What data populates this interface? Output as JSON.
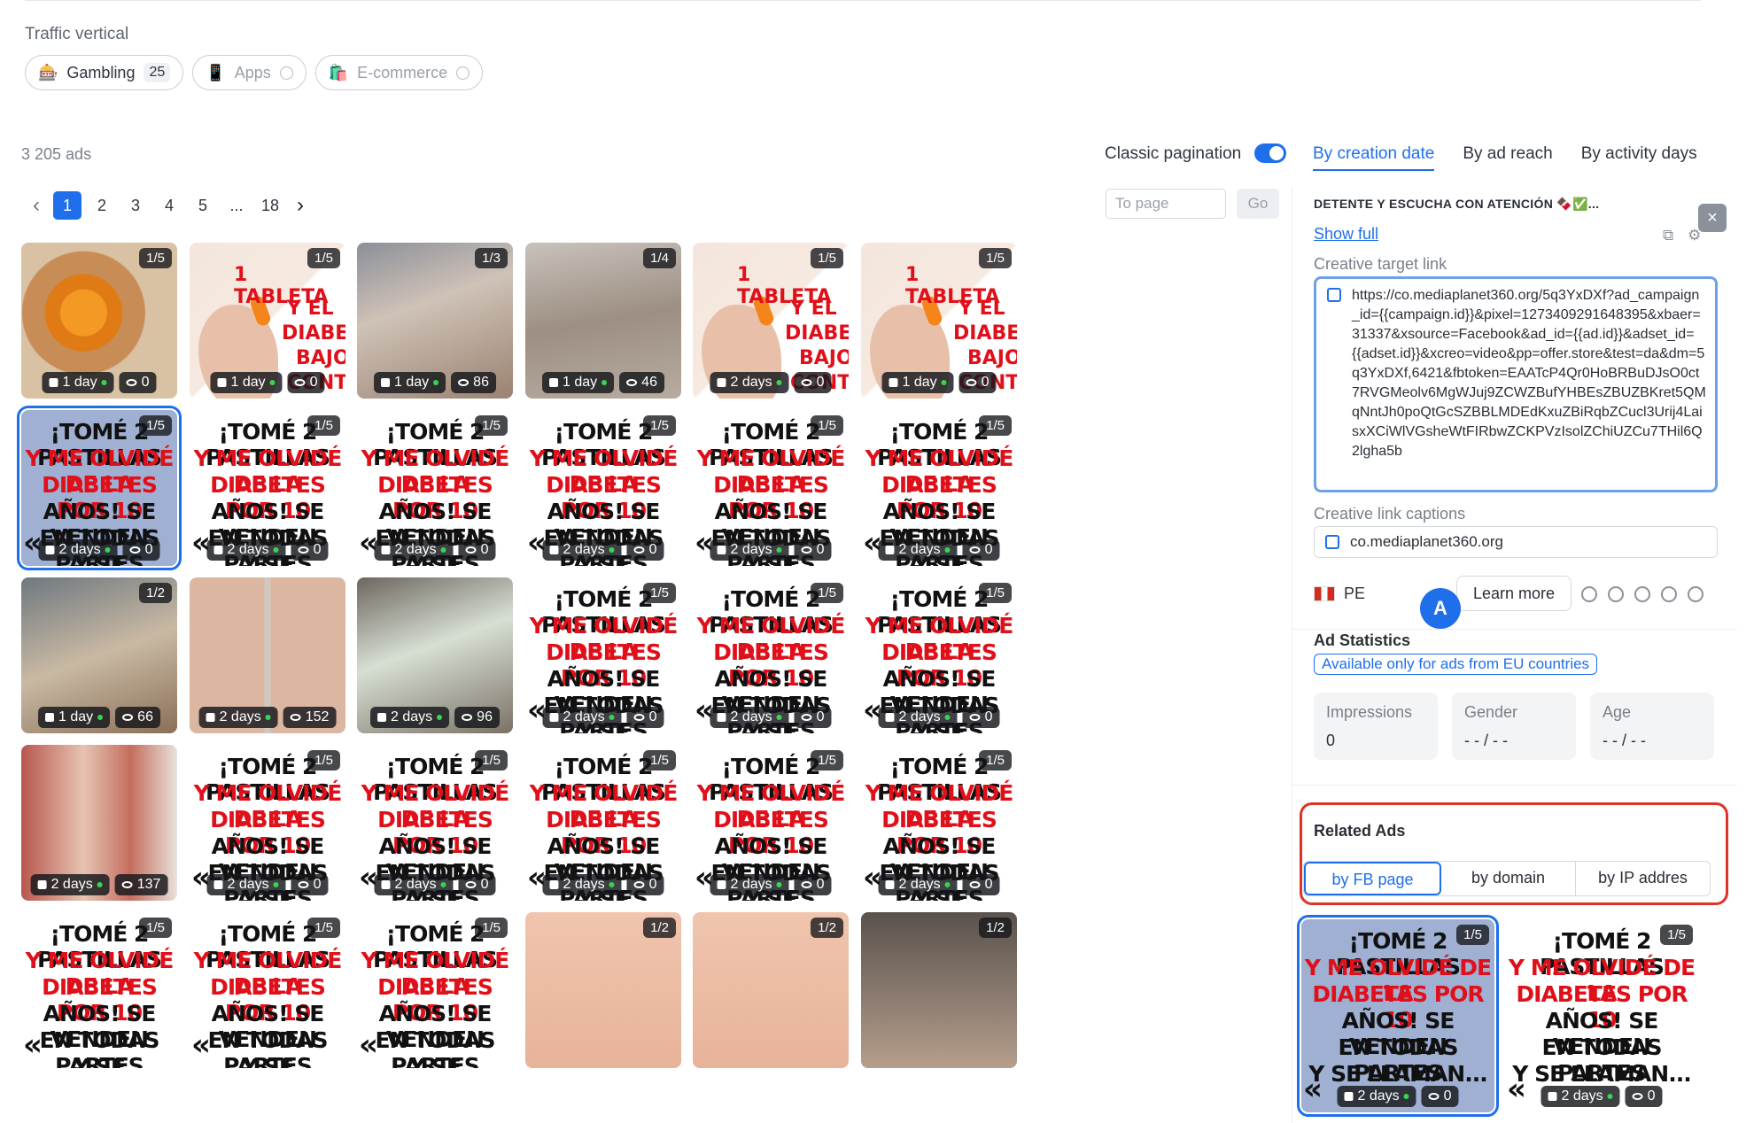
{
  "traffic": {
    "label": "Traffic vertical",
    "chips": [
      {
        "emoji": "🎰",
        "label": "Gambling",
        "count": "25"
      },
      {
        "emoji": "📱",
        "label": "Apps"
      },
      {
        "emoji": "🛍️",
        "label": "E-commerce"
      }
    ]
  },
  "results": {
    "count_text": "3 205 ads"
  },
  "pagination": {
    "classic_label": "Classic pagination",
    "classic_enabled": true,
    "pages": [
      "1",
      "2",
      "3",
      "4",
      "5",
      "...",
      "18"
    ],
    "current": "1",
    "to_page_placeholder": "To page",
    "go_label": "Go"
  },
  "sort": {
    "tabs": [
      "By creation date",
      "By ad reach",
      "By activity days"
    ],
    "active": "By creation date"
  },
  "text_ad": {
    "l1": "¡TOMÉ 2 PASTILLAS",
    "l2": "Y ME OLVIDÉ DE LA",
    "l3": "DIABETES POR 10",
    "l4": "AÑOS! SE VENDEN",
    "l5": "EN TODAS PARTES",
    "l6": "Y SE LLAMAN..."
  },
  "hand_ad": {
    "l1": "1 TABLETA",
    "l2": "—",
    "l3": "Y EL",
    "l4": "DIABETES",
    "l5": "BAJO",
    "l6": "CONTROL!"
  },
  "cards": [
    {
      "type": "photo",
      "style": "photo-fruit",
      "counter": "1/5",
      "days": "1 day",
      "views": "0"
    },
    {
      "type": "hand",
      "counter": "1/5",
      "days": "1 day",
      "views": "0"
    },
    {
      "type": "photo",
      "style": "photo-foot",
      "counter": "1/3",
      "days": "1 day",
      "views": "86"
    },
    {
      "type": "photo",
      "style": "photo-foot2",
      "counter": "1/4",
      "days": "1 day",
      "views": "46"
    },
    {
      "type": "hand",
      "counter": "1/5",
      "days": "2 days",
      "views": "0"
    },
    {
      "type": "hand",
      "counter": "1/5",
      "days": "1 day",
      "views": "0"
    },
    {
      "type": "text",
      "counter": "1/5",
      "days": "2 days",
      "views": "0",
      "selected": true
    },
    {
      "type": "text",
      "counter": "1/5",
      "days": "2 days",
      "views": "0"
    },
    {
      "type": "text",
      "counter": "1/5",
      "days": "2 days",
      "views": "0"
    },
    {
      "type": "text",
      "counter": "1/5",
      "days": "2 days",
      "views": "0"
    },
    {
      "type": "text",
      "counter": "1/5",
      "days": "2 days",
      "views": "0"
    },
    {
      "type": "text",
      "counter": "1/5",
      "days": "2 days",
      "views": "0"
    },
    {
      "type": "photo",
      "style": "photo-foot3",
      "counter": "1/2",
      "days": "1 day",
      "views": "66"
    },
    {
      "type": "photo",
      "style": "photo-feet",
      "counter": "",
      "days": "2 days",
      "views": "152"
    },
    {
      "type": "photo",
      "style": "photo-bandage",
      "counter": "",
      "days": "2 days",
      "views": "96"
    },
    {
      "type": "text",
      "counter": "1/5",
      "days": "2 days",
      "views": "0"
    },
    {
      "type": "text",
      "counter": "1/5",
      "days": "2 days",
      "views": "0"
    },
    {
      "type": "text",
      "counter": "1/5",
      "days": "2 days",
      "views": "0"
    },
    {
      "type": "photo",
      "style": "photo-legs",
      "counter": "",
      "days": "2 days",
      "views": "137"
    },
    {
      "type": "text",
      "counter": "1/5",
      "days": "2 days",
      "views": "0"
    },
    {
      "type": "text",
      "counter": "1/5",
      "days": "2 days",
      "views": "0"
    },
    {
      "type": "text",
      "counter": "1/5",
      "days": "2 days",
      "views": "0"
    },
    {
      "type": "text",
      "counter": "1/5",
      "days": "2 days",
      "views": "0"
    },
    {
      "type": "text",
      "counter": "1/5",
      "days": "2 days",
      "views": "0"
    },
    {
      "type": "text",
      "counter": "1/5",
      "days": "",
      "views": ""
    },
    {
      "type": "text",
      "counter": "1/5",
      "days": "",
      "views": ""
    },
    {
      "type": "text",
      "counter": "1/5",
      "days": "",
      "views": ""
    },
    {
      "type": "photo",
      "style": "photo-toe",
      "counter": "1/2",
      "days": "",
      "views": ""
    },
    {
      "type": "photo",
      "style": "photo-toe",
      "counter": "1/2",
      "days": "",
      "views": ""
    },
    {
      "type": "photo",
      "style": "photo-dark",
      "counter": "1/2",
      "days": "",
      "views": ""
    }
  ],
  "panel": {
    "caption": "DETENTE Y ESCUCHA CON ATENCIÓN 🍫✅...",
    "show_full": "Show full",
    "target_link_label": "Creative target link",
    "target_link": "https://co.mediaplanet360.org/5q3YxDXf?ad_campaign_id={{campaign.id}}&pixel=1273409291648395&xbaer=31337&xsource=Facebook&ad_id={{ad.id}}&adset_id={{adset.id}}&xcreo=video&pp=offer.store&test=da&dm=5q3YxDXf,6421&fbtoken=EAATcP4Qr0HoBRBuDJsO0ct7RVGMeolv6MgWJuj9ZCWZBufYHBEsZBUZBKret5QMqNntJh0poQtGcSZBBLMDEdKxuZBiRqbZCucl3Urij4LaisxXCiWlVGsheWtFIRbwZCKPVzIsolZChiUZCu7THil6Q2lgha5b",
    "link_captions_label": "Creative link captions",
    "link_caption": "co.mediaplanet360.org",
    "country": "PE",
    "cta": "Learn more",
    "avatar_letter": "A",
    "ad_statistics_title": "Ad Statistics",
    "eu_note": "Available only for ads from EU countries",
    "stats": [
      {
        "title": "Impressions",
        "value": "0"
      },
      {
        "title": "Gender",
        "value": "- - / - -"
      },
      {
        "title": "Age",
        "value": "- - / - -"
      }
    ],
    "related_title": "Related Ads",
    "related_tabs": [
      "by FB page",
      "by domain",
      "by IP addres"
    ],
    "related_active": "by FB page",
    "related_cards": [
      {
        "type": "text",
        "counter": "1/5",
        "days": "2 days",
        "views": "0",
        "selected": true
      },
      {
        "type": "text",
        "counter": "1/5",
        "days": "2 days",
        "views": "0"
      }
    ]
  },
  "colors": {
    "accent": "#1f6feb",
    "highlight_red": "#e03225",
    "ad_red": "#e0101a"
  }
}
